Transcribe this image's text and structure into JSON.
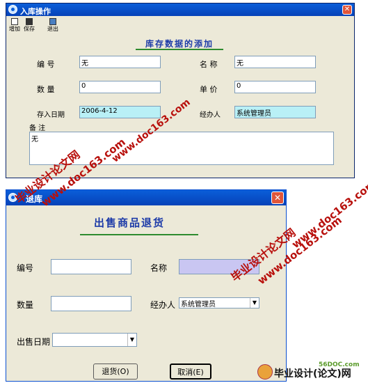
{
  "window1": {
    "title": "入库操作",
    "toolbar": {
      "add": "增加",
      "save": "保存",
      "exit": "退出"
    },
    "heading": "库存数据的添加",
    "fields": {
      "code_label": "编 号",
      "code_value": "无",
      "name_label": "名 称",
      "name_value": "无",
      "qty_label": "数 量",
      "qty_value": "0",
      "unit_label": "单 价",
      "unit_value": "0",
      "date_label": "存入日期",
      "date_value": "2006-4-12",
      "handler_label": "经办人",
      "handler_value": "系统管理员",
      "note_label": "备 注",
      "note_value": "无"
    }
  },
  "window2": {
    "title": "退库",
    "heading": "出售商品退货",
    "fields": {
      "code_label": "编号",
      "code_value": "",
      "name_label": "名称",
      "name_value": "",
      "qty_label": "数量",
      "qty_value": "",
      "handler_label": "经办人",
      "handler_value": "系统管理员",
      "date_label": "出售日期",
      "date_value": ""
    },
    "buttons": {
      "return": "退货(O)",
      "cancel": "取消(E)"
    }
  },
  "watermarks": {
    "brand": "毕业设计论文网",
    "site": "www.doc163.com",
    "footer_site": "56DOC.com",
    "footer_brand": "毕业设计(论文)网"
  }
}
